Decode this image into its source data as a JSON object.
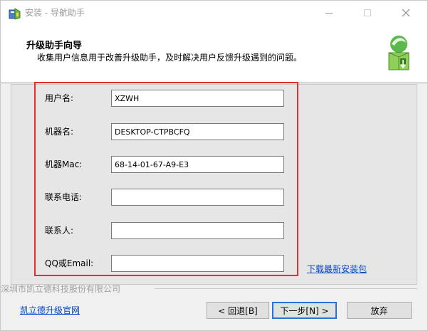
{
  "window": {
    "title": "安装 - 导航助手"
  },
  "header": {
    "title": "升级助手向导",
    "subtitle": "收集用户信息用于改善升级助手，及时解决用户反馈升级遇到的问题。"
  },
  "form": {
    "fields": [
      {
        "label": "用户名:",
        "value": ""
      },
      {
        "label": "机器名:",
        "value": ""
      },
      {
        "label": "机器Mac:",
        "value": ""
      },
      {
        "label": "联系电话:",
        "value": ""
      },
      {
        "label": "联系人:",
        "value": ""
      },
      {
        "label": "QQ或Email:",
        "value": ""
      }
    ],
    "values": {
      "username": "XZWH",
      "machine_name": "DESKTOP-CTPBCFQ",
      "machine_mac": "68-14-01-67-A9-E3",
      "phone": "",
      "contact": "",
      "qq_email": ""
    }
  },
  "links": {
    "download": "下载最新安装包",
    "official": "凯立德升级官网"
  },
  "footer": {
    "company": "深圳市凯立德科技股份有限公司"
  },
  "buttons": {
    "back": "< 回退[B]",
    "next": "下一步[N] >",
    "cancel": "放弃"
  },
  "colors": {
    "highlight_frame": "#e0302f",
    "link": "#0046c8",
    "default_button_border": "#2a72d5"
  }
}
